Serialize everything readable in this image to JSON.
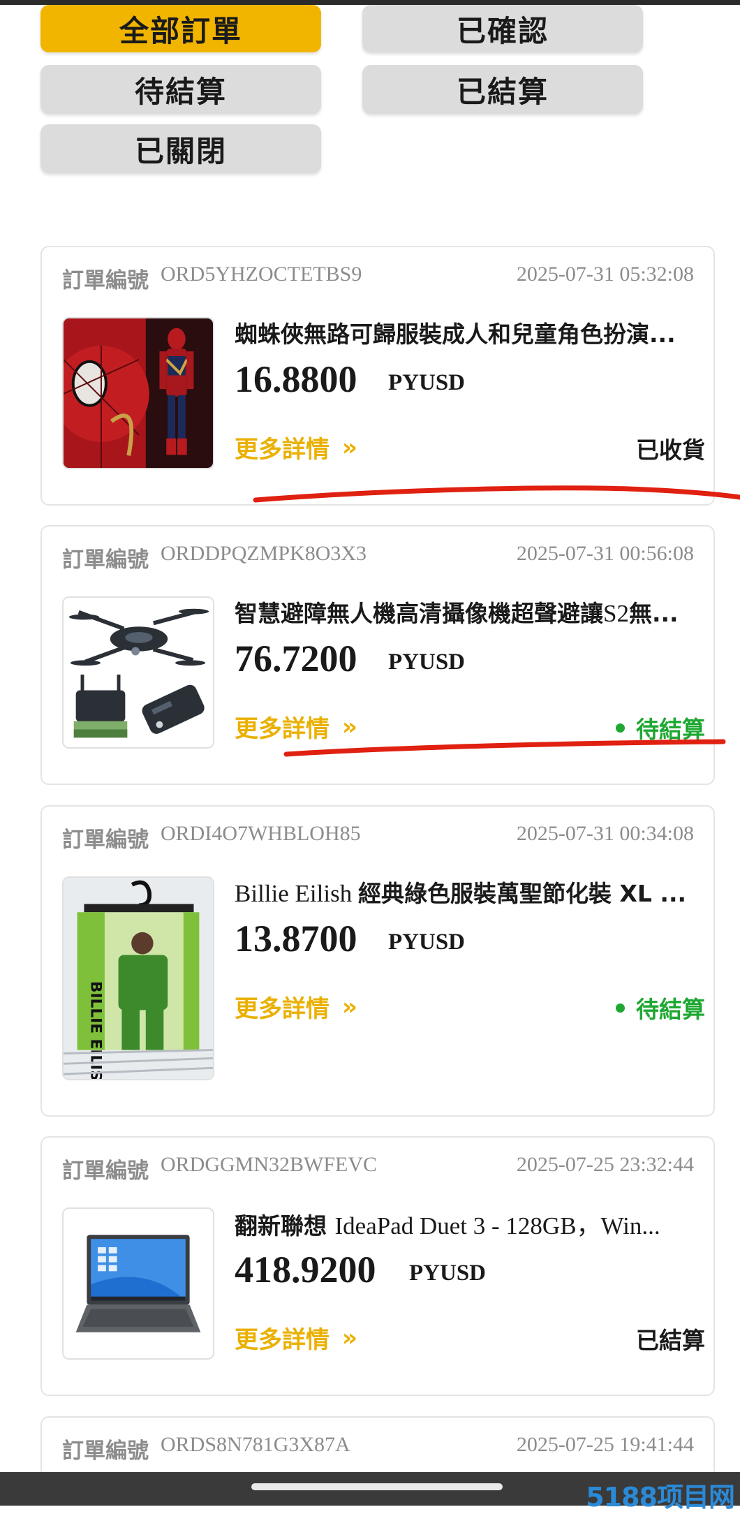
{
  "filters": [
    "全部訂單",
    "已確認",
    "待結算",
    "已結算",
    "已關閉"
  ],
  "active_filter": "全部訂單",
  "order_label": "訂單編號",
  "details_label": "更多詳情",
  "details_chevron": "»",
  "orders": [
    {
      "order_no": "ORD5YHZOCTETBS9",
      "date": "2025-07-31 05:32:08",
      "title_cjk": "蜘蛛俠無路可歸服裝成人和兒童角色扮演...",
      "title_latin": "",
      "title_cjk2": "",
      "price": "16.8800",
      "currency": "PYUSD",
      "status": "已收貨",
      "thumb_icon": "spiderman-costume-image"
    },
    {
      "order_no": "ORDDPQZMPK8O3X3",
      "date": "2025-07-31 00:56:08",
      "title_cjk": "智慧避障無人機高清攝像機超聲避讓",
      "title_latin": "S2",
      "title_cjk2": "無...",
      "price": "76.7200",
      "currency": "PYUSD",
      "status": "待結算",
      "thumb_icon": "drone-image"
    },
    {
      "order_no": "ORDI4O7WHBLOH85",
      "date": "2025-07-31 00:34:08",
      "title_cjk": "",
      "title_latin": "Billie Eilish ",
      "title_cjk2": "經典綠色服裝萬聖節化裝 XL ...",
      "price": "13.8700",
      "currency": "PYUSD",
      "status": "待結算",
      "thumb_icon": "green-costume-image"
    },
    {
      "order_no": "ORDGGMN32BWFEVC",
      "date": "2025-07-25 23:32:44",
      "title_cjk": "翻新聯想 ",
      "title_latin": "IdeaPad Duet 3 - 128GB，Win...",
      "title_cjk2": "",
      "price": "418.9200",
      "currency": "PYUSD",
      "status": "已結算",
      "thumb_icon": "laptop-tablet-image"
    },
    {
      "order_no": "ORDS8N781G3X87A",
      "date": "2025-07-25 19:41:44"
    }
  ],
  "watermark": "5188项目网",
  "colors": {
    "accent_yellow": "#f1b500",
    "status_green": "#1ea832",
    "annotation_red": "#e02010"
  }
}
